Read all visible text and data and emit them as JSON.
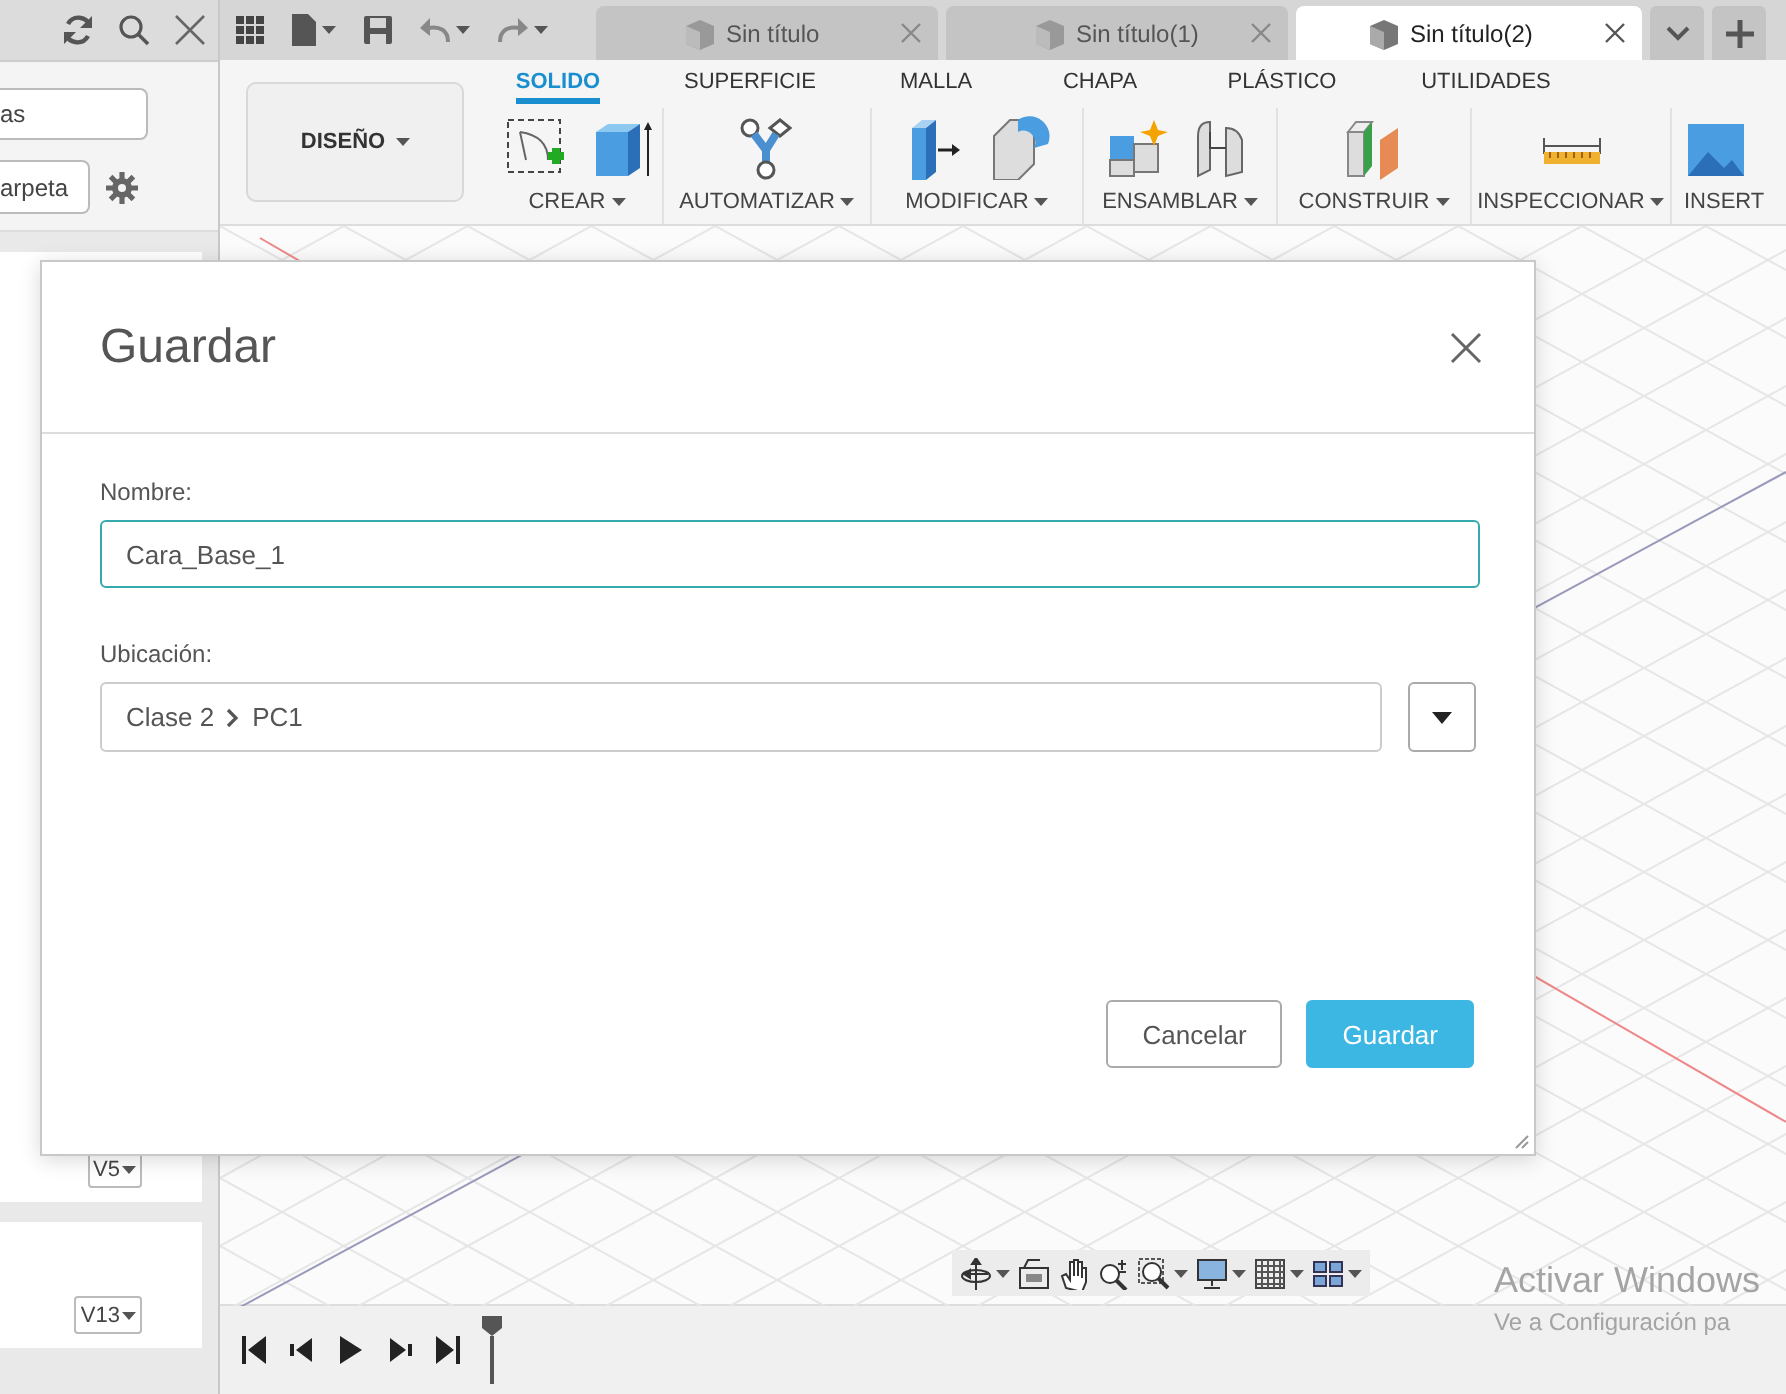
{
  "side_panel": {
    "search_field": {
      "value": "as"
    },
    "folder_button": "arpeta",
    "versions": [
      "V5",
      "V13"
    ]
  },
  "document_tabs": [
    {
      "label": "Sin título",
      "selected": false
    },
    {
      "label": "Sin título(1)",
      "selected": false
    },
    {
      "label": "Sin título(2)",
      "selected": true
    }
  ],
  "ribbon": {
    "workspace": "DISEÑO",
    "tabs": [
      {
        "label": "SOLIDO",
        "selected": true
      },
      {
        "label": "SUPERFICIE",
        "selected": false
      },
      {
        "label": "MALLA",
        "selected": false
      },
      {
        "label": "CHAPA",
        "selected": false
      },
      {
        "label": "PLÁSTICO",
        "selected": false
      },
      {
        "label": "UTILIDADES",
        "selected": false
      }
    ],
    "groups": [
      "CREAR",
      "AUTOMATIZAR",
      "MODIFICAR",
      "ENSAMBLAR",
      "CONSTRUIR",
      "INSPECCIONAR",
      "INSERT"
    ]
  },
  "dialog": {
    "title": "Guardar",
    "name_label": "Nombre:",
    "name_value": "Cara_Base_1",
    "location_label": "Ubicación:",
    "location_path": [
      "Clase 2",
      "PC1"
    ],
    "buttons": [
      {
        "label": "Cancelar",
        "kind": "secondary"
      },
      {
        "label": "Guardar",
        "kind": "primary"
      }
    ]
  },
  "activation_notice": {
    "title": "Activar Windows",
    "subtitle": "Ve a Configuración pa"
  }
}
